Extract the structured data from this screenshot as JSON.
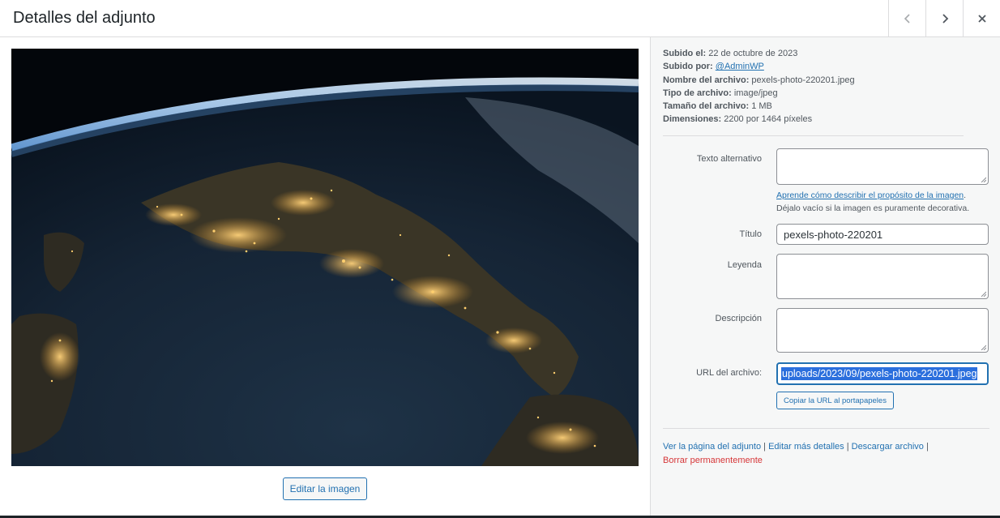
{
  "header": {
    "title": "Detalles del adjunto",
    "prev_icon": "chevron-left-icon",
    "next_icon": "chevron-right-icon",
    "close_icon": "close-icon"
  },
  "main": {
    "image_alt": "Earth at night from orbit showing lit-up Italy",
    "edit_button": "Editar la imagen"
  },
  "details": {
    "uploaded_on_label": "Subido el:",
    "uploaded_on_value": "22 de octubre de 2023",
    "uploaded_by_label": "Subido por:",
    "uploaded_by_value": "@AdminWP",
    "filename_label": "Nombre del archivo:",
    "filename_value": "pexels-photo-220201.jpeg",
    "filetype_label": "Tipo de archivo:",
    "filetype_value": "image/jpeg",
    "filesize_label": "Tamaño del archivo:",
    "filesize_value": "1 MB",
    "dimensions_label": "Dimensiones:",
    "dimensions_value": "2200 por 1464 píxeles"
  },
  "form": {
    "alt_label": "Texto alternativo",
    "alt_value": "",
    "alt_help_link": "Aprende cómo describir el propósito de la imagen",
    "alt_help_period": ".",
    "alt_help_text": "Déjalo vacío si la imagen es puramente decorativa.",
    "title_label": "Título",
    "title_value": "pexels-photo-220201",
    "caption_label": "Leyenda",
    "caption_value": "",
    "description_label": "Descripción",
    "description_value": "",
    "url_label": "URL del archivo:",
    "url_value": "uploads/2023/09/pexels-photo-220201.jpeg",
    "copy_button": "Copiar la URL al portapapeles"
  },
  "actions": {
    "view_page": "Ver la página del adjunto",
    "edit_more": "Editar más detalles",
    "download": "Descargar archivo",
    "delete": "Borrar permanentemente",
    "separator": " | "
  },
  "colors": {
    "accent": "#2271b1",
    "danger": "#d63638",
    "sidebar_bg": "#f6f7f7",
    "border": "#dcdcde"
  }
}
